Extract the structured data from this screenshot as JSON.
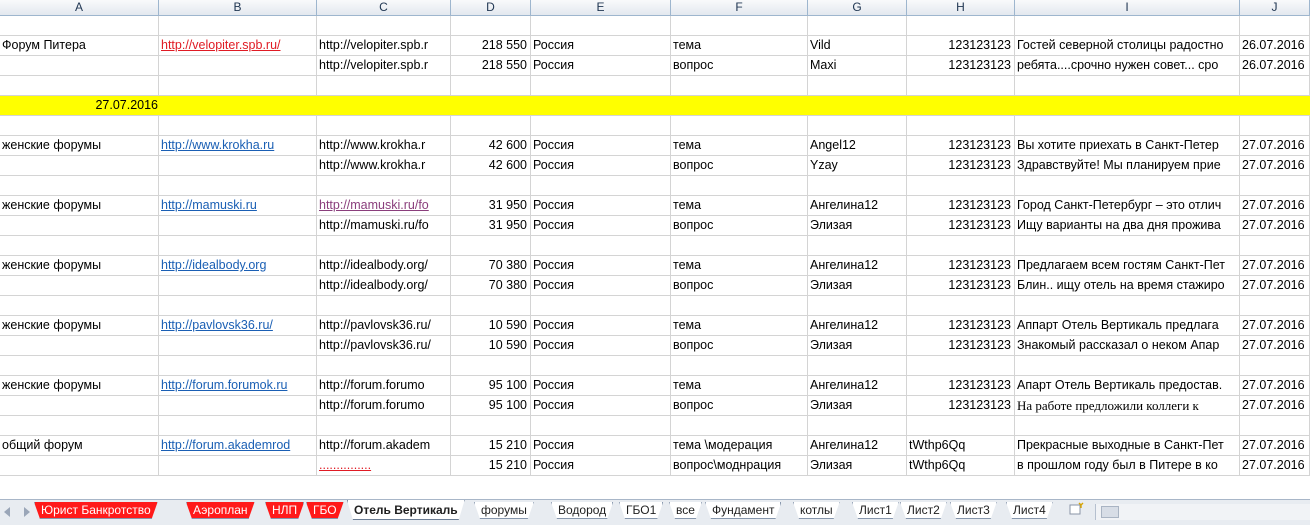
{
  "columns": [
    "A",
    "B",
    "C",
    "D",
    "E",
    "F",
    "G",
    "H",
    "I",
    "J"
  ],
  "rows": [
    {
      "A": "Форум Питера",
      "B": "http://velopiter.spb.ru/",
      "B_style": "link-red",
      "C": "http://velopiter.spb.r",
      "D": "218 550",
      "E": "Россия",
      "F": "тема",
      "G": "Vild",
      "H": "123123123",
      "I": "Гостей северной столицы радостно",
      "J": "26.07.2016"
    },
    {
      "A": "",
      "B": "",
      "C": "http://velopiter.spb.r",
      "D": "218 550",
      "E": "Россия",
      "F": "вопрос",
      "G": " Maxi",
      "H": "123123123",
      "I": "ребята....срочно нужен совет... сро",
      "J": "26.07.2016"
    },
    {
      "A": "",
      "B": "",
      "C": "",
      "D": "",
      "E": "",
      "F": "",
      "G": "",
      "H": "",
      "I": "",
      "J": ""
    },
    {
      "yellow": true,
      "A": "27.07.2016"
    },
    {
      "A": "",
      "B": "",
      "C": "",
      "D": "",
      "E": "",
      "F": "",
      "G": "",
      "H": "",
      "I": "",
      "J": ""
    },
    {
      "A": "женские форумы",
      "B": "http://www.krokha.ru",
      "B_style": "link",
      "C": "http://www.krokha.r",
      "D": "42 600",
      "E": "Россия",
      "F": "тема",
      "G": "Angel12",
      "H": "123123123",
      "I": "Вы хотите приехать в Санкт-Петер",
      "J": "27.07.2016"
    },
    {
      "A": "",
      "B": "",
      "C": "http://www.krokha.r",
      "D": "42 600",
      "E": "Россия",
      "F": "вопрос",
      "G": "Yzay",
      "H": "123123123",
      "I": "Здравствуйте! Мы планируем прие",
      "J": "27.07.2016"
    },
    {
      "A": "",
      "B": "",
      "C": "",
      "D": "",
      "E": "",
      "F": "",
      "G": "",
      "H": "",
      "I": "",
      "J": ""
    },
    {
      "A": "женские форумы",
      "B": "http://mamuski.ru",
      "B_style": "link",
      "C": "http://mamuski.ru/fo",
      "C_style": "link-visited",
      "D": "31 950",
      "E": "Россия",
      "F": "тема",
      "G": "Ангелина12",
      "H": "123123123",
      "I": "Город Санкт-Петербург – это отлич",
      "J": "27.07.2016"
    },
    {
      "A": "",
      "B": "",
      "C": "http://mamuski.ru/fo",
      "D": "31 950",
      "E": "Россия",
      "F": "вопрос",
      "G": "Элизая",
      "H": "123123123",
      "I": "Ищу варианты на два дня прожива",
      "J": "27.07.2016"
    },
    {
      "A": "",
      "B": "",
      "C": "",
      "D": "",
      "E": "",
      "F": "",
      "G": "",
      "H": "",
      "I": "",
      "J": ""
    },
    {
      "A": "женские форумы",
      "B": "http://idealbody.org",
      "B_style": "link",
      "C": "http://idealbody.org/",
      "D": "70 380",
      "E": "Россия",
      "F": "тема",
      "G": "Ангелина12",
      "H": "123123123",
      "I": "Предлагаем всем гостям Санкт-Пет",
      "J": "27.07.2016"
    },
    {
      "A": "",
      "B": "",
      "C": "http://idealbody.org/",
      "D": "70 380",
      "E": "Россия",
      "F": "вопрос",
      "G": "Элизая",
      "H": "123123123",
      "I": "Блин.. ищу отель на время стажиро",
      "J": "27.07.2016"
    },
    {
      "A": "",
      "B": "",
      "C": "",
      "D": "",
      "E": "",
      "F": "",
      "G": "",
      "H": "",
      "I": "",
      "J": ""
    },
    {
      "A": "женские форумы",
      "B": "http://pavlovsk36.ru/",
      "B_style": "link",
      "C": "http://pavlovsk36.ru/",
      "D": "10 590",
      "E": "Россия",
      "F": "тема",
      "G": "Ангелина12",
      "H": "123123123",
      "I": "Аппарт Отель Вертикаль предлага",
      "J": "27.07.2016"
    },
    {
      "A": "",
      "B": "",
      "C": "http://pavlovsk36.ru/",
      "D": "10 590",
      "E": "Россия",
      "F": "вопрос",
      "G": "Элизая",
      "H": "123123123",
      "I": "Знакомый рассказал о неком Апар",
      "J": "27.07.2016"
    },
    {
      "A": "",
      "B": "",
      "C": "",
      "D": "",
      "E": "",
      "F": "",
      "G": "",
      "H": "",
      "I": "",
      "J": ""
    },
    {
      "A": "женские форумы",
      "B": "http://forum.forumok.ru",
      "B_style": "link",
      "C": "http://forum.forumo",
      "D": "95 100",
      "E": "Россия",
      "F": "тема",
      "G": "Ангелина12",
      "H": "123123123",
      "I": "Апарт Отель Вертикаль предостав.",
      "J": "27.07.2016"
    },
    {
      "A": "",
      "B": "",
      "C": "http://forum.forumo",
      "D": "95 100",
      "E": "Россия",
      "F": "вопрос",
      "G": "Элизая",
      "H": "123123123",
      "I": "На работе предложили коллеги к",
      "I_style": "serif",
      "J": "27.07.2016"
    },
    {
      "A": "",
      "B": "",
      "C": "",
      "D": "",
      "E": "",
      "F": "",
      "G": "",
      "H": "",
      "I": "",
      "J": ""
    },
    {
      "A": "общий форум",
      "B": "http://forum.akademrod",
      "B_style": "link",
      "C": "http://forum.akadem",
      "D": "15 210",
      "E": "Россия",
      "F": "тема \\модерация",
      "G": "Ангелина12",
      "H": "tWthp6Qq",
      "H_align": "left",
      "I": "Прекрасные выходные в Санкт-Пет",
      "J": "27.07.2016"
    },
    {
      "A": "",
      "B": "",
      "C": "...............",
      "C_style": "dotted-red",
      "D": "15 210",
      "E": "Россия",
      "F": "вопрос\\моднрация",
      "G": "Элизая",
      "H": "tWthp6Qq",
      "H_align": "left",
      "I": "в прошлом году был в Питере в ко",
      "J": "27.07.2016"
    }
  ],
  "tabs": [
    {
      "label": "Юрист Банкротство",
      "style": "red"
    },
    {
      "label": "Аэроплан",
      "style": "red"
    },
    {
      "label": "НЛП",
      "style": "red"
    },
    {
      "label": "ГБО",
      "style": "red"
    },
    {
      "label": "Отель Вертикаль",
      "style": "active"
    },
    {
      "label": "форумы",
      "style": ""
    },
    {
      "label": "Водород",
      "style": ""
    },
    {
      "label": "ГБО1",
      "style": ""
    },
    {
      "label": "все",
      "style": ""
    },
    {
      "label": "Фундамент",
      "style": ""
    },
    {
      "label": "котлы",
      "style": ""
    },
    {
      "label": "Лист1",
      "style": ""
    },
    {
      "label": "Лист2",
      "style": ""
    },
    {
      "label": "Лист3",
      "style": ""
    },
    {
      "label": "Лист4",
      "style": ""
    }
  ],
  "icons": {
    "nav": "sheet-nav-arrows-icon",
    "new_sheet": "insert-sheet-icon"
  },
  "colors": {
    "highlight": "#ffff00",
    "red_tab": "#ff1a1a",
    "link": "#1a5fb4"
  }
}
